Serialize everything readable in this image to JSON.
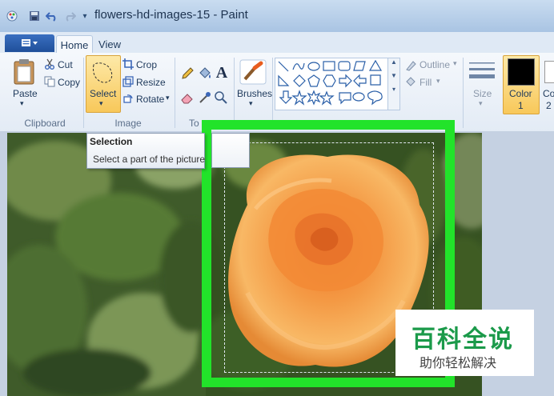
{
  "window": {
    "title": "flowers-hd-images-15 - Paint"
  },
  "tabs": [
    {
      "label": "Home"
    },
    {
      "label": "View"
    }
  ],
  "clipboard": {
    "paste": "Paste",
    "cut": "Cut",
    "copy": "Copy",
    "group": "Clipboard"
  },
  "image_group": {
    "select": "Select",
    "crop": "Crop",
    "resize": "Resize",
    "rotate": "Rotate",
    "group": "Image"
  },
  "tools_group": {
    "group": "To"
  },
  "brushes": {
    "label": "Brushes"
  },
  "shape_options": {
    "outline": "Outline",
    "fill": "Fill"
  },
  "size": {
    "label": "Size"
  },
  "colors": {
    "color1_line1": "Color",
    "color1_line2": "1",
    "color2_partial": "Co",
    "color2_partial_line2": "2",
    "color1_value": "#000000"
  },
  "tooltip": {
    "title": "Selection",
    "text": "Select a part of the picture"
  },
  "watermark": {
    "line1": "百科全说",
    "line2": "助你轻松解决"
  },
  "colors_theme": {
    "highlight_green": "#22e32a",
    "rose": "#f29b46",
    "foliage": "#3f5b2a"
  }
}
